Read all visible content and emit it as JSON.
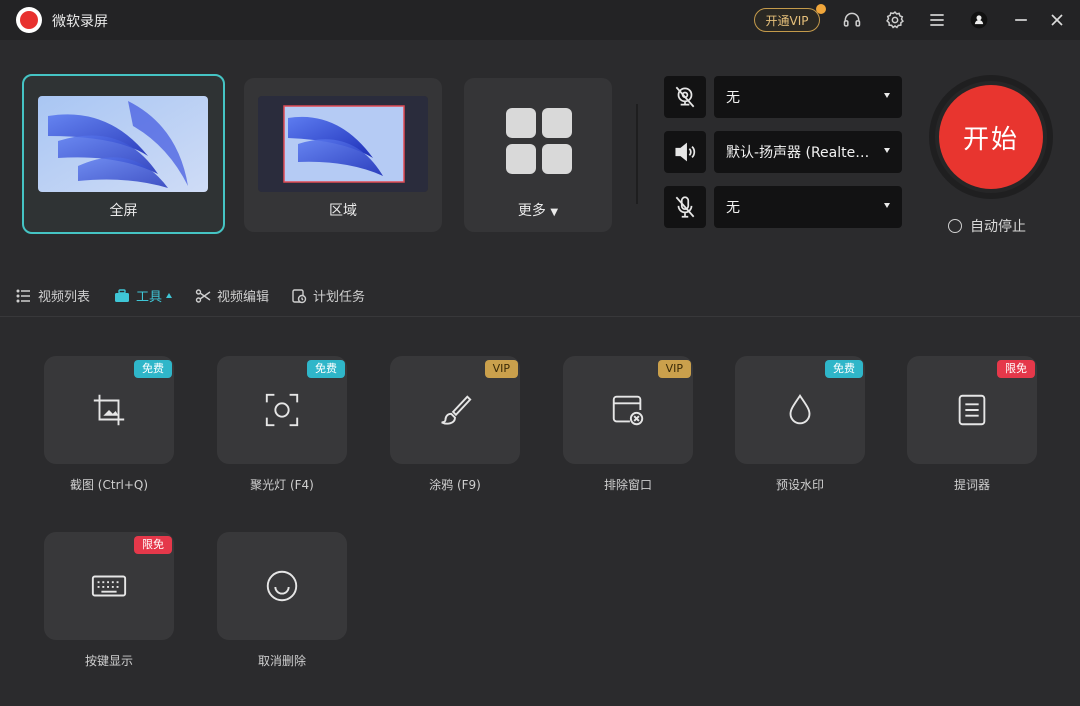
{
  "app": {
    "title": "微软录屏"
  },
  "titlebar": {
    "vip_label": "开通VIP"
  },
  "modes": [
    {
      "label": "全屏",
      "active": true
    },
    {
      "label": "区域",
      "active": false
    },
    {
      "label": "更多",
      "active": false
    }
  ],
  "sources": {
    "camera": {
      "value": "无"
    },
    "speaker": {
      "value": "默认-扬声器 (Realtek(R) Audio)"
    },
    "microphone": {
      "value": "无"
    }
  },
  "start": {
    "label": "开始",
    "auto_stop_label": "自动停止"
  },
  "nav": [
    {
      "label": "视频列表"
    },
    {
      "label": "工具"
    },
    {
      "label": "视频编辑"
    },
    {
      "label": "计划任务"
    }
  ],
  "tools": [
    {
      "label": "截图 (Ctrl+Q)",
      "badge": "免费",
      "icon": "crop-icon"
    },
    {
      "label": "聚光灯 (F4)",
      "badge": "免费",
      "icon": "spotlight-icon"
    },
    {
      "label": "涂鸦 (F9)",
      "badge": "VIP",
      "icon": "brush-icon"
    },
    {
      "label": "排除窗口",
      "badge": "VIP",
      "icon": "exclude-window-icon"
    },
    {
      "label": "预设水印",
      "badge": "免费",
      "icon": "watermark-drop-icon"
    },
    {
      "label": "提词器",
      "badge": "限免",
      "icon": "teleprompter-icon"
    },
    {
      "label": "按键显示",
      "badge": "限免",
      "icon": "keyboard-icon"
    },
    {
      "label": "取消删除",
      "badge": "",
      "icon": "smile-icon"
    }
  ],
  "colors": {
    "accent": "#45c4c4",
    "start": "#e8352f",
    "vip": "#caa04c",
    "limited": "#e5384a"
  }
}
